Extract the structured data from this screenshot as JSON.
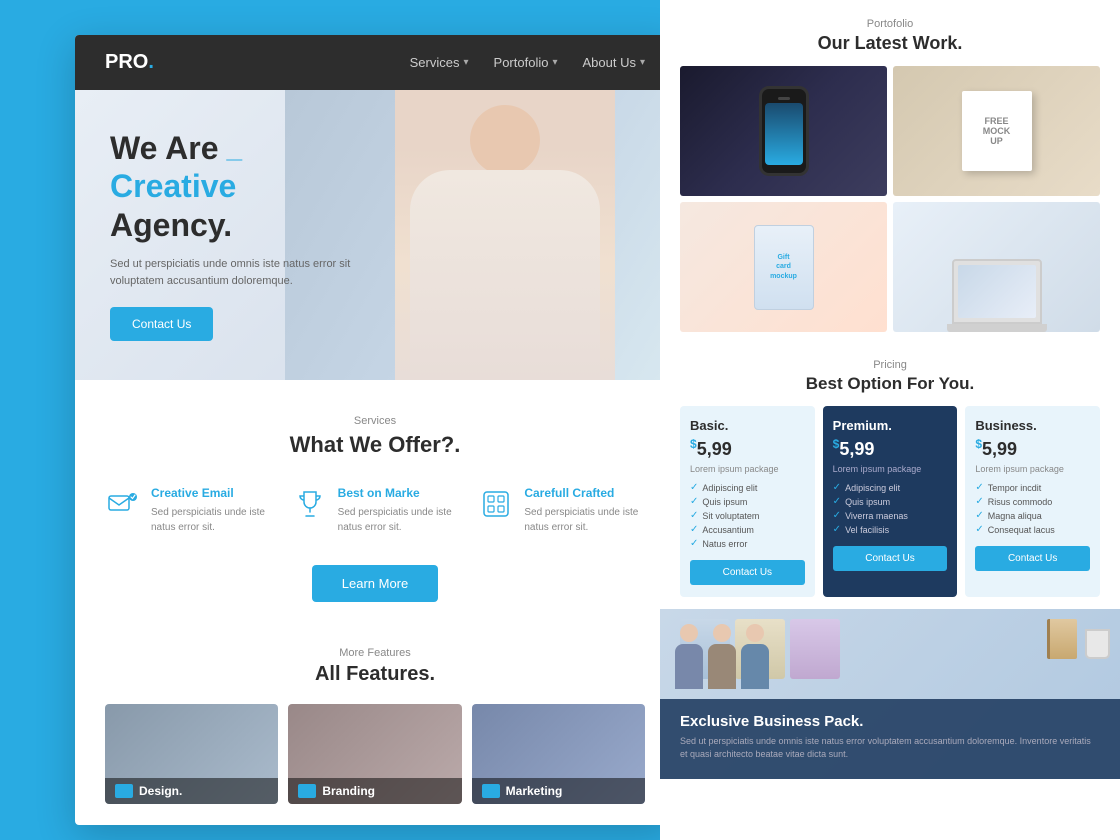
{
  "page": {
    "background_color": "#29abe2"
  },
  "left_mockup": {
    "navbar": {
      "brand": "PRO",
      "brand_dot": ".",
      "nav_items": [
        {
          "label": "Services",
          "has_chevron": true
        },
        {
          "label": "Portofolio",
          "has_chevron": true
        },
        {
          "label": "About Us",
          "has_chevron": true
        }
      ]
    },
    "hero": {
      "title_line1": "We Are",
      "title_dash": "_",
      "title_line2_blue": "Creative",
      "title_line2_dark": "Agency.",
      "subtitle": "Sed ut perspiciatis unde omnis iste natus error sit voluptatem accusantium doloremque.",
      "cta_button": "Contact Us"
    },
    "services": {
      "label": "Services",
      "title": "What We Offer?.",
      "items": [
        {
          "title": "Creative Email",
          "description": "Sed perspiciatis unde iste natus error sit."
        },
        {
          "title": "Best on Marke",
          "description": "Sed perspiciatis unde iste natus error sit."
        },
        {
          "title": "Carefull Crafted",
          "description": "Sed perspiciatis unde iste natus error sit."
        }
      ],
      "learn_more_button": "Learn More"
    },
    "features": {
      "label": "More Features",
      "title": "All Features.",
      "items": [
        {
          "label": "Design."
        },
        {
          "label": "Branding"
        },
        {
          "label": "Marketing"
        }
      ]
    }
  },
  "right_panel": {
    "portfolio": {
      "label": "Portofolio",
      "title": "Our Latest Work.",
      "items": [
        {
          "type": "phone"
        },
        {
          "type": "book"
        },
        {
          "type": "gift_card"
        },
        {
          "type": "laptop"
        }
      ]
    },
    "pricing": {
      "label": "Pricing",
      "title": "Best Option For You.",
      "plans": [
        {
          "name": "Basic.",
          "price": "5,99",
          "currency": "$",
          "description": "Lorem ipsum package",
          "featured": false,
          "features": [
            "Adipiscing elit",
            "Quis ipsum",
            "Sit voluptatem",
            "Accusantium",
            "Natus error"
          ],
          "button": "Contact Us"
        },
        {
          "name": "Premium.",
          "price": "5,99",
          "currency": "$",
          "description": "Lorem ipsum package",
          "featured": true,
          "features": [
            "Adipiscing elit",
            "Quis ipsum",
            "Viverra maenas",
            "Vel facilisis"
          ],
          "button": "Contact Us"
        },
        {
          "name": "Business.",
          "price": "5,99",
          "currency": "$",
          "description": "Lorem ipsum package",
          "featured": false,
          "features": [
            "Tempor incdit",
            "Risus commodo",
            "Magna aliqua",
            "Consequat lacus"
          ],
          "button": "Contact Us"
        }
      ]
    },
    "bottom": {
      "title": "Exclusive Business Pack.",
      "text": "Sed ut perspiciatis unde omnis iste natus error voluptatem accusantium doloremque. Inventore veritatis et quasi architecto beatae vitae dicta sunt."
    }
  }
}
